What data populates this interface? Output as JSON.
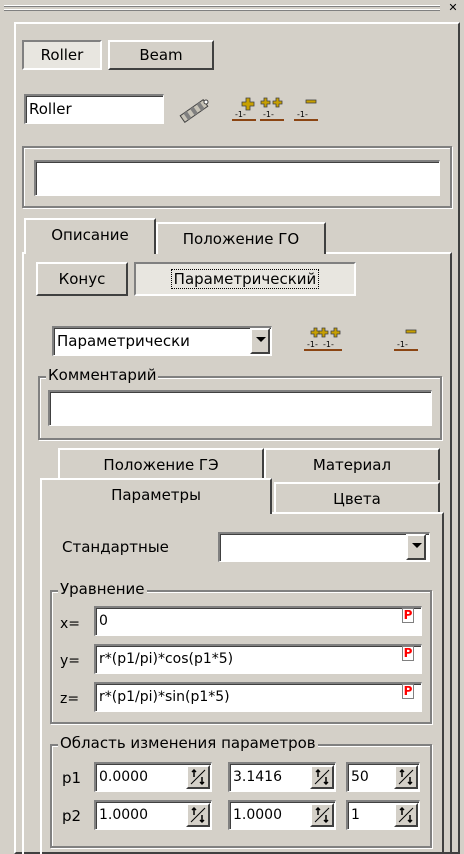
{
  "top_tabs": {
    "roller": "Roller",
    "beam": "Beam"
  },
  "name_field": {
    "value": "Roller"
  },
  "description_field": {
    "value": ""
  },
  "main_tabs": {
    "description": "Описание",
    "position_go": "Положение ГО"
  },
  "shape_buttons": {
    "cone": "Конус",
    "parametric": "Параметрический"
  },
  "shape_select": {
    "value": "Параметрически"
  },
  "comment": {
    "label": "Комментарий",
    "value": ""
  },
  "sub_tabs": {
    "position_ge": "Положение ГЭ",
    "material": "Материал",
    "parameters": "Параметры",
    "colors": "Цвета"
  },
  "standard": {
    "label": "Стандартные",
    "value": ""
  },
  "equation": {
    "label": "Уравнение",
    "rows": [
      {
        "label": "x=",
        "value": "0"
      },
      {
        "label": "y=",
        "value": "r*(p1/pi)*cos(p1*5)"
      },
      {
        "label": "z=",
        "value": "r*(p1/pi)*sin(p1*5)"
      }
    ],
    "p_marker": "P"
  },
  "range": {
    "label": "Область изменения параметров",
    "rows": [
      {
        "label": "p1",
        "from": "0.0000",
        "to": "3.1416",
        "steps": "50"
      },
      {
        "label": "p2",
        "from": "1.0000",
        "to": "1.0000",
        "steps": "1"
      }
    ]
  },
  "colors": {
    "accent_red": "#ff0000",
    "brown": "#8b4513",
    "ochre": "#c8a000"
  }
}
